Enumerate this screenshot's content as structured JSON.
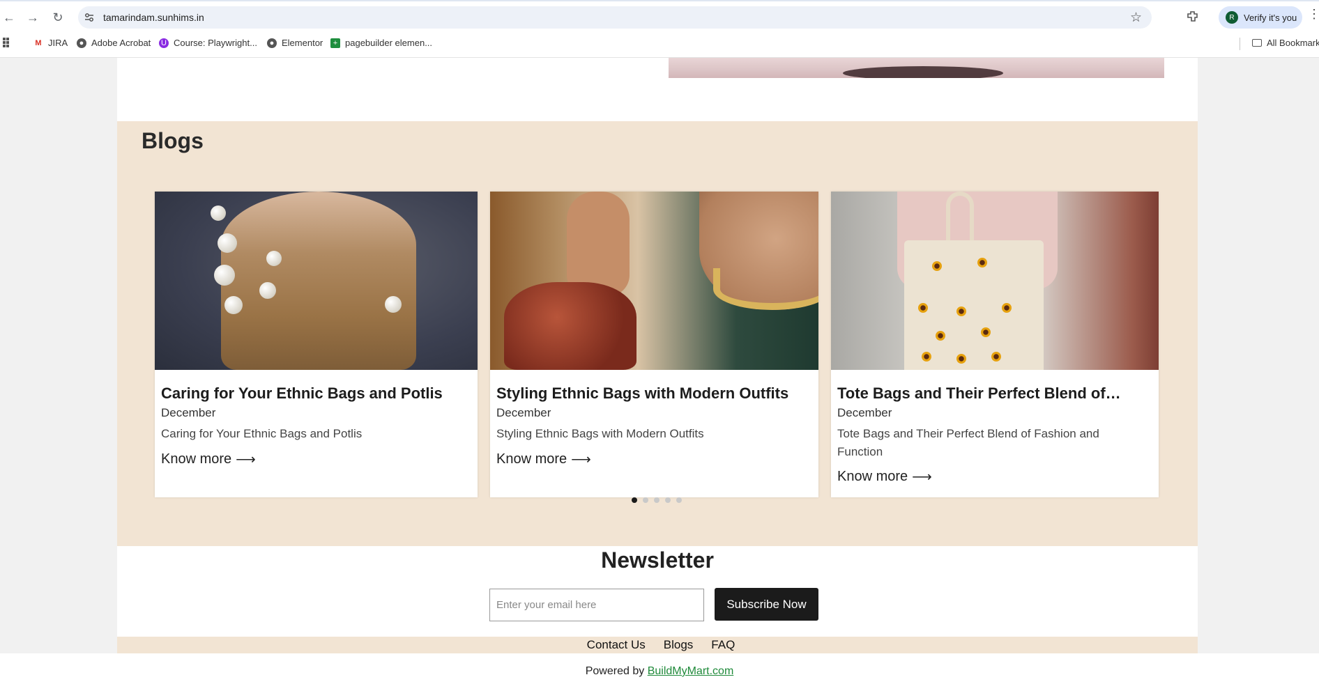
{
  "browser": {
    "url": "tamarindam.sunhims.in",
    "verify_label": "Verify it's you",
    "verify_avatar_letter": "R",
    "bookmarks": [
      {
        "label": "JIRA",
        "icon": "gmail-icon"
      },
      {
        "label": "Adobe Acrobat",
        "icon": "globe-icon"
      },
      {
        "label": "Course: Playwright...",
        "icon": "course-icon"
      },
      {
        "label": "Elementor",
        "icon": "globe-icon"
      },
      {
        "label": "pagebuilder elemen...",
        "icon": "sheets-icon"
      }
    ],
    "all_bookmarks_label": "All Bookmarks"
  },
  "blogs": {
    "title": "Blogs",
    "cards": [
      {
        "title": "Caring for Your Ethnic Bags and Potlis",
        "date": "December",
        "description": "Caring for Your Ethnic Bags and Potlis",
        "link": "Know more"
      },
      {
        "title": "Styling Ethnic Bags with Modern Outfits",
        "date": "December",
        "description": "Styling Ethnic Bags with Modern Outfits",
        "link": "Know more"
      },
      {
        "title": "Tote Bags and Their Perfect Blend of…",
        "date": "December",
        "description": "Tote Bags and Their Perfect Blend of Fashion and Function",
        "link": "Know more"
      }
    ],
    "carousel": {
      "total_pages": 5,
      "active_page": 1
    }
  },
  "newsletter": {
    "title": "Newsletter",
    "email_placeholder": "Enter your email here",
    "email_value": "",
    "subscribe_label": "Subscribe Now"
  },
  "footer": {
    "links": [
      "Contact Us",
      "Blogs",
      "FAQ"
    ],
    "powered_prefix": "Powered by",
    "powered_link": "BuildMyMart.com"
  },
  "colors": {
    "section_bg": "#f2e4d3",
    "button_bg": "#1b1b1b",
    "link_green": "#1f8a3a"
  }
}
